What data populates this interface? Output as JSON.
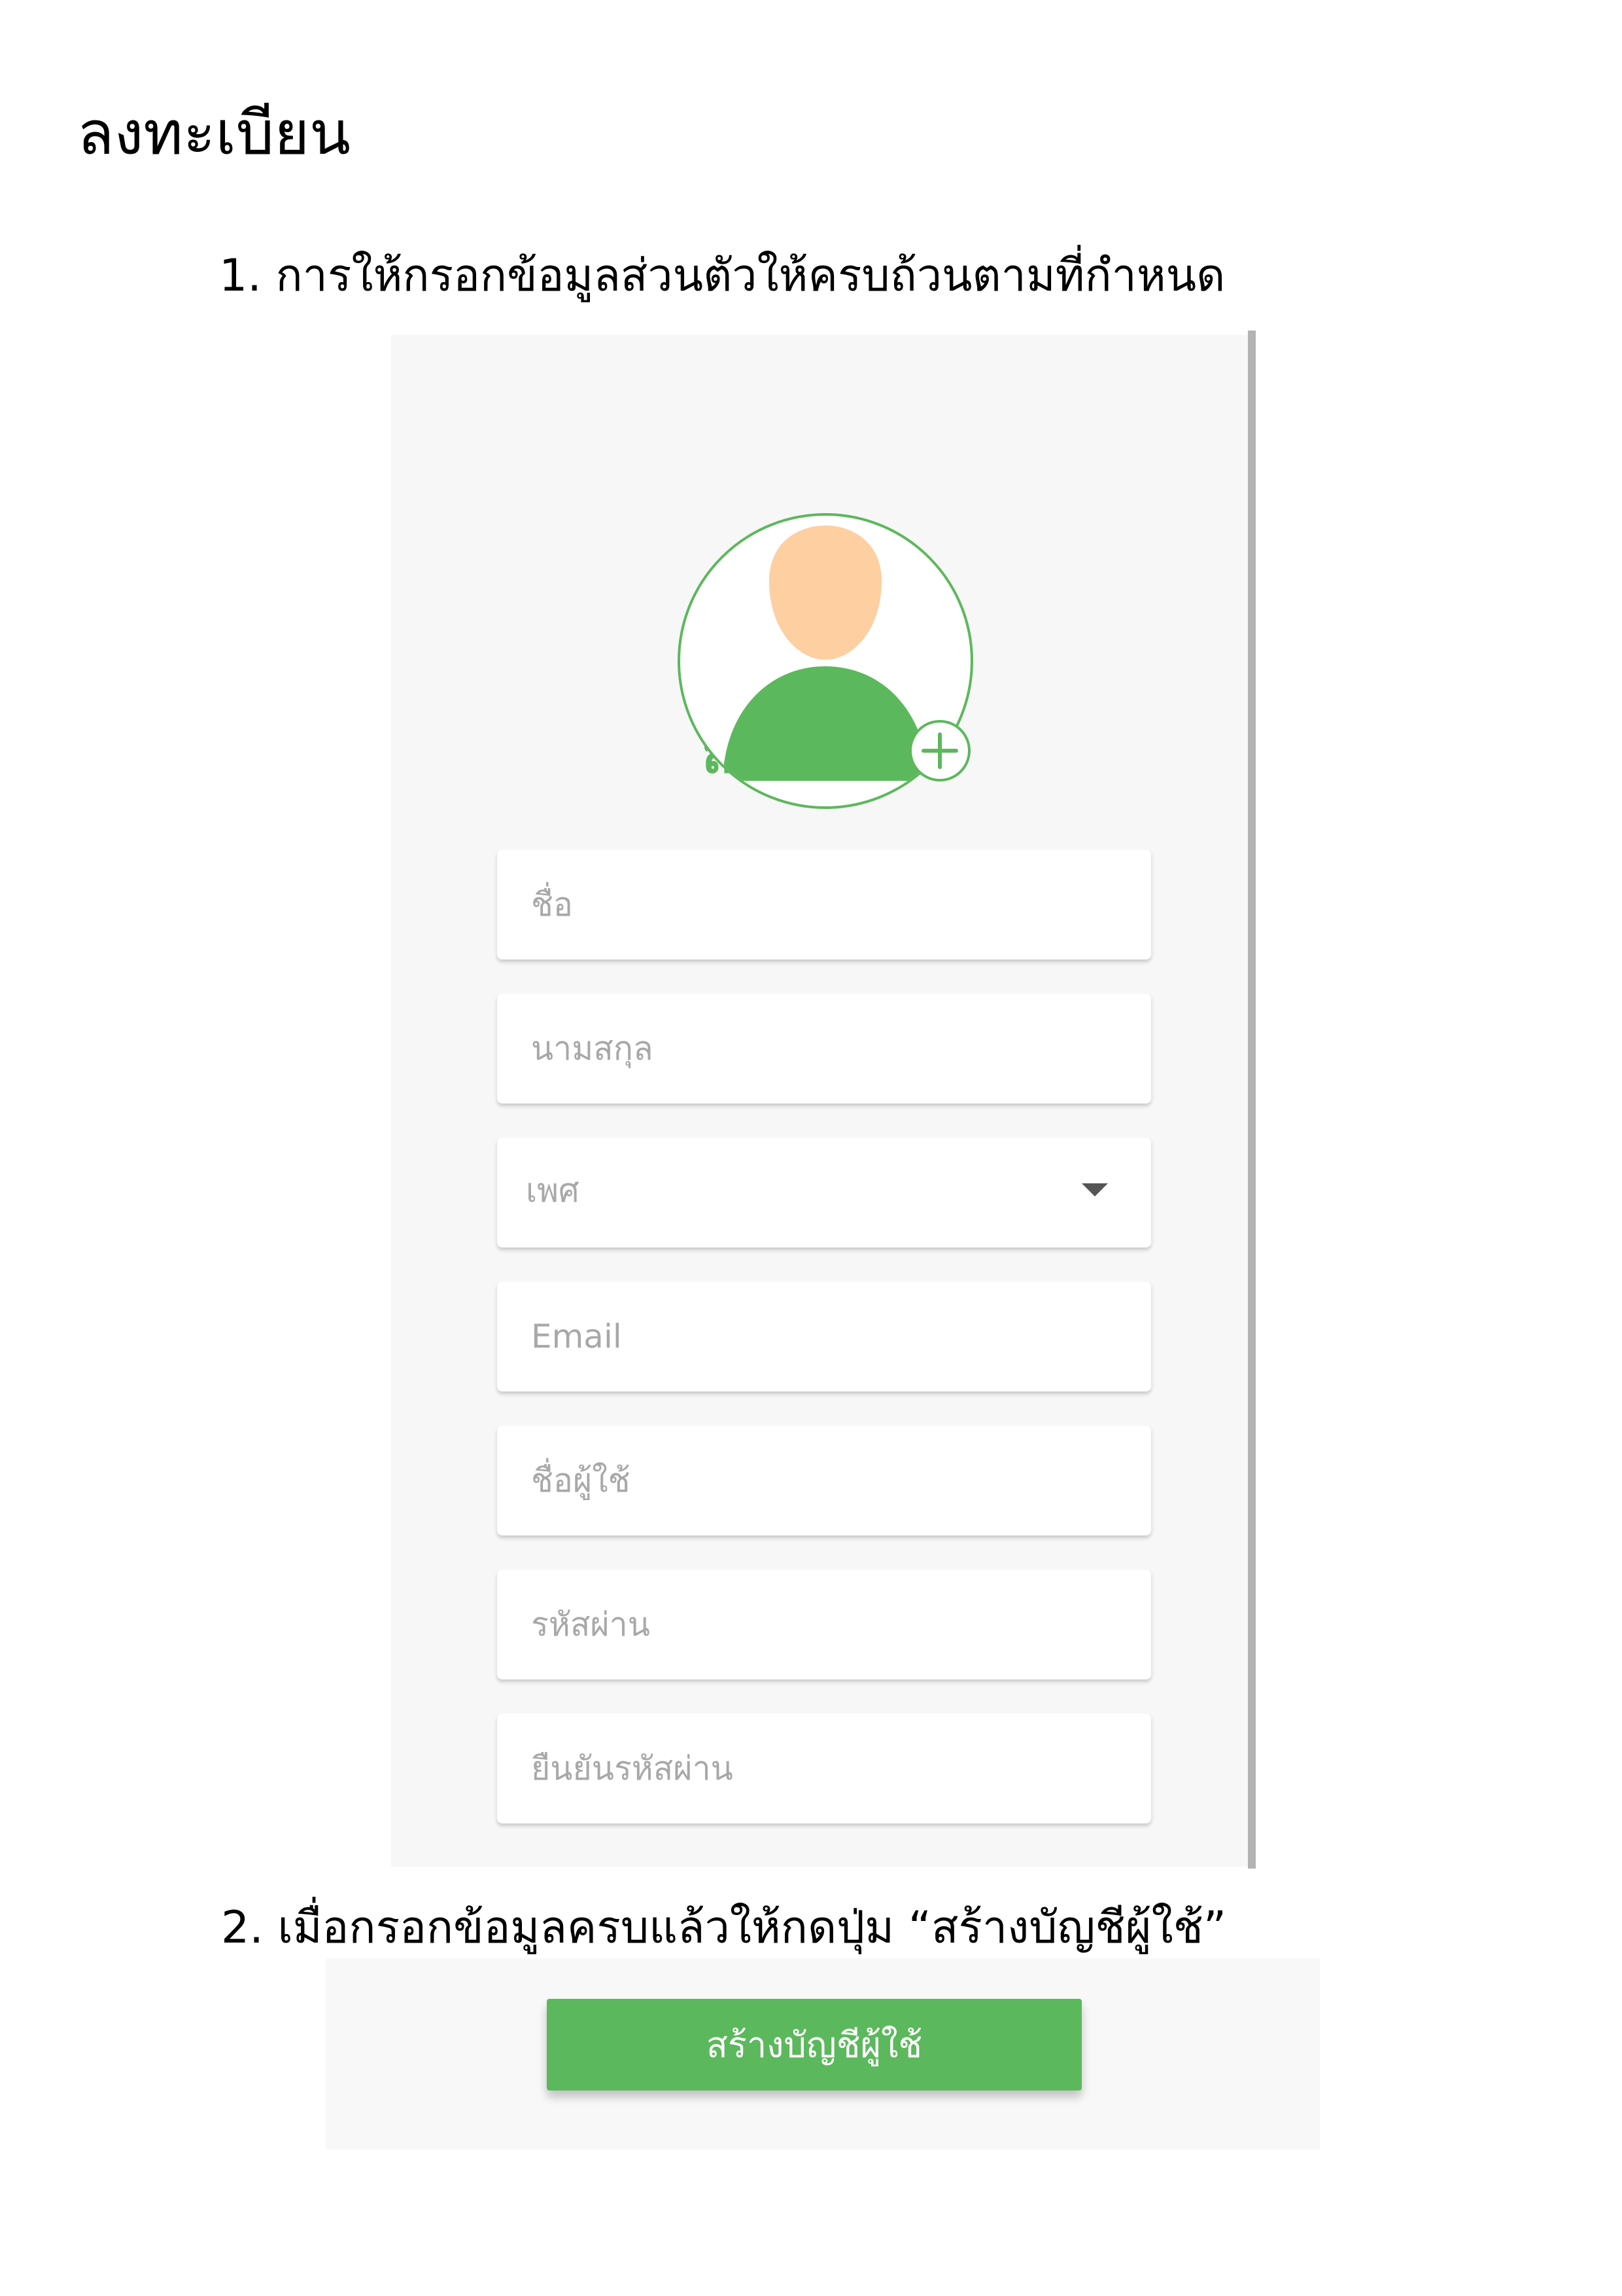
{
  "document": {
    "heading": "ลงทะเบียน",
    "step1": "1. การให้กรอกข้อมูลส่วนตัวให้ครบถ้วนตามที่กำหนด",
    "step2": "2. เมื่อกรอกข้อมูลครบแล้วให้กดปุ่ม “สร้างบัญชีผู้ใช้”"
  },
  "form": {
    "title": "ลงทะเบียน",
    "first_name_placeholder": "ชื่อ",
    "last_name_placeholder": "นามสกุล",
    "gender_placeholder": "เพศ",
    "email_placeholder": "Email",
    "username_placeholder": "ชื่อผู้ใช้",
    "password_placeholder": "รหัสผ่าน",
    "confirm_password_placeholder": "ยืนยันรหัสผ่าน",
    "submit_label": "สร้างบัญชีผู้ใช้"
  },
  "icons": {
    "avatar": "user-avatar-icon",
    "add": "plus-circle-icon",
    "dropdown": "caret-down-icon"
  },
  "colors": {
    "accent": "#5cb85c",
    "skin": "#fdcfa1",
    "panel_bg": "#f7f7f7",
    "placeholder": "#a8a8a8"
  }
}
